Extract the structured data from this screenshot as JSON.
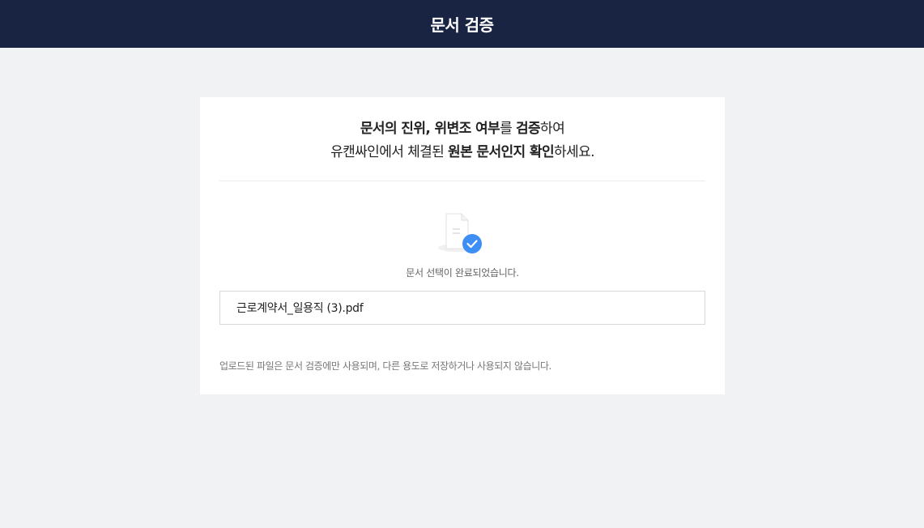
{
  "header": {
    "title": "문서 검증"
  },
  "intro": {
    "line1": [
      {
        "text": "문서의 진위, 위변조 여부",
        "bold": true
      },
      {
        "text": "를 ",
        "bold": false
      },
      {
        "text": "검증",
        "bold": true
      },
      {
        "text": "하여",
        "bold": false
      }
    ],
    "line2": [
      {
        "text": "유캔싸인에서 체결된 ",
        "bold": false
      },
      {
        "text": "원본 문서인지 확인",
        "bold": true
      },
      {
        "text": "하세요.",
        "bold": false
      }
    ]
  },
  "upload": {
    "icon": "document-check-icon",
    "status_text": "문서 선택이 완료되었습니다.",
    "file_name": "근로계약서_일용직 (3).pdf",
    "notice": "업로드된 파일은 문서 검증에만 사용되며, 다른 용도로 저장하거나 사용되지 않습니다."
  },
  "colors": {
    "header_bg": "#192443",
    "page_bg": "#f1f2f4",
    "check_badge": "#3d8ef5"
  }
}
